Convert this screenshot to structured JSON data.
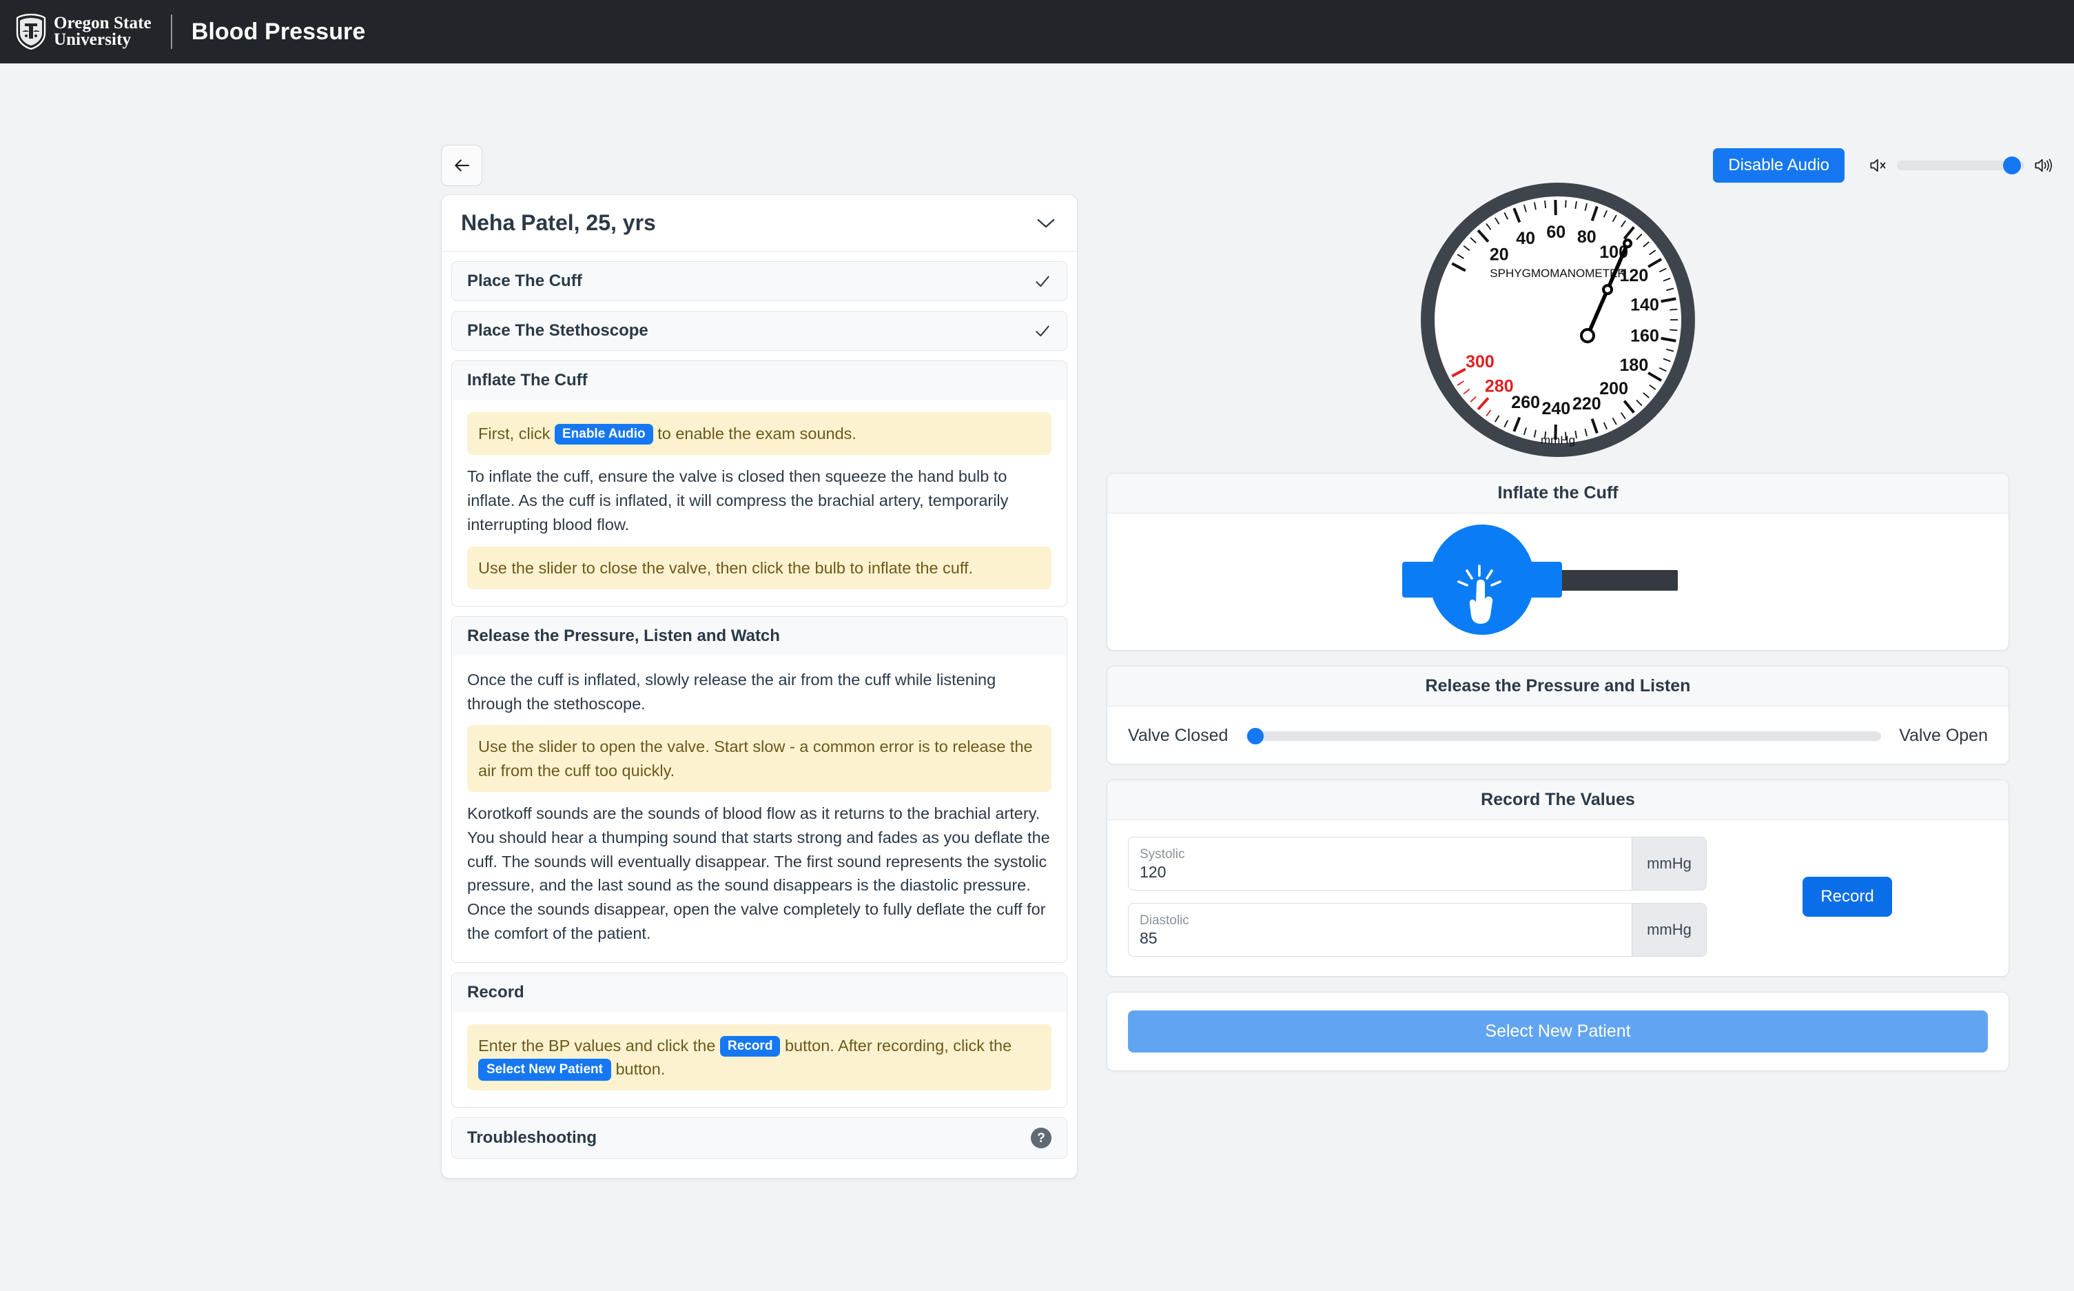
{
  "header": {
    "university_line1": "Oregon State",
    "university_line2": "University",
    "app_title": "Blood Pressure",
    "logo_icon": "osu-beaver-shield-icon"
  },
  "toolbar": {
    "back_icon": "arrow-left-icon",
    "audio_button_label": "Disable Audio",
    "mute_icon": "volume-mute-icon",
    "volume_icon": "volume-up-icon",
    "volume_percent": 90
  },
  "patient": {
    "name_line": "Neha Patel, 25, yrs",
    "chevron_icon": "chevron-down-icon"
  },
  "steps": [
    {
      "title": "Place The Cuff",
      "status_icon": "check-icon"
    },
    {
      "title": "Place The Stethoscope",
      "status_icon": "check-icon"
    }
  ],
  "inflate_section": {
    "title": "Inflate The Cuff",
    "note_before": "First, click",
    "note_pill": "Enable Audio",
    "note_after": "to enable the exam sounds.",
    "paragraph": "To inflate the cuff, ensure the valve is closed then squeeze the hand bulb to inflate. As the cuff is inflated, it will compress the brachial artery, temporarily interrupting blood flow.",
    "tip": "Use the slider to close the valve, then click the bulb to inflate the cuff."
  },
  "release_section": {
    "title": "Release the Pressure, Listen and Watch",
    "paragraph1": "Once the cuff is inflated, slowly release the air from the cuff while listening through the stethoscope.",
    "tip": "Use the slider to open the valve. Start slow - a common error is to release the air from the cuff too quickly.",
    "paragraph2": "Korotkoff sounds are the sounds of blood flow as it returns to the brachial artery. You should hear a thumping sound that starts strong and fades as you deflate the cuff. The sounds will eventually disappear. The first sound represents the systolic pressure, and the last sound as the sound disappears is the diastolic pressure. Once the sounds disappear, open the valve completely to fully deflate the cuff for the comfort of the patient."
  },
  "record_section": {
    "title": "Record",
    "note_part1": "Enter the BP values and click the",
    "note_pill1": "Record",
    "note_part2": "button. After recording, click the",
    "note_pill2": "Select New Patient",
    "note_part3": "button."
  },
  "troubleshooting": {
    "title": "Troubleshooting",
    "help_icon": "question-mark-icon",
    "help_glyph": "?"
  },
  "gauge": {
    "face_label": "SPHYGMOMANOMETER",
    "unit_label": "mmHg",
    "major_ticks": [
      20,
      40,
      60,
      80,
      100,
      120,
      140,
      160,
      180,
      200,
      220,
      240,
      260,
      280,
      300
    ],
    "red_ticks": [
      280,
      300
    ],
    "min": 0,
    "max": 300,
    "needle_value": 103,
    "bezel_color": "#3d444c",
    "face_color": "#ffffff",
    "danger_color": "#e02020"
  },
  "inflate_card": {
    "title": "Inflate the Cuff",
    "bulb_icon": "hand-tap-bulb-icon",
    "bulb_color": "#0a7cf5"
  },
  "valve_card": {
    "title": "Release the Pressure and Listen",
    "left_label": "Valve Closed",
    "right_label": "Valve Open",
    "value_percent": 1.5
  },
  "values_card": {
    "title": "Record The Values",
    "fields": [
      {
        "label": "Systolic",
        "value": "120",
        "unit": "mmHg"
      },
      {
        "label": "Diastolic",
        "value": "85",
        "unit": "mmHg"
      }
    ],
    "record_button": "Record"
  },
  "new_patient_card": {
    "button_label": "Select New Patient"
  }
}
